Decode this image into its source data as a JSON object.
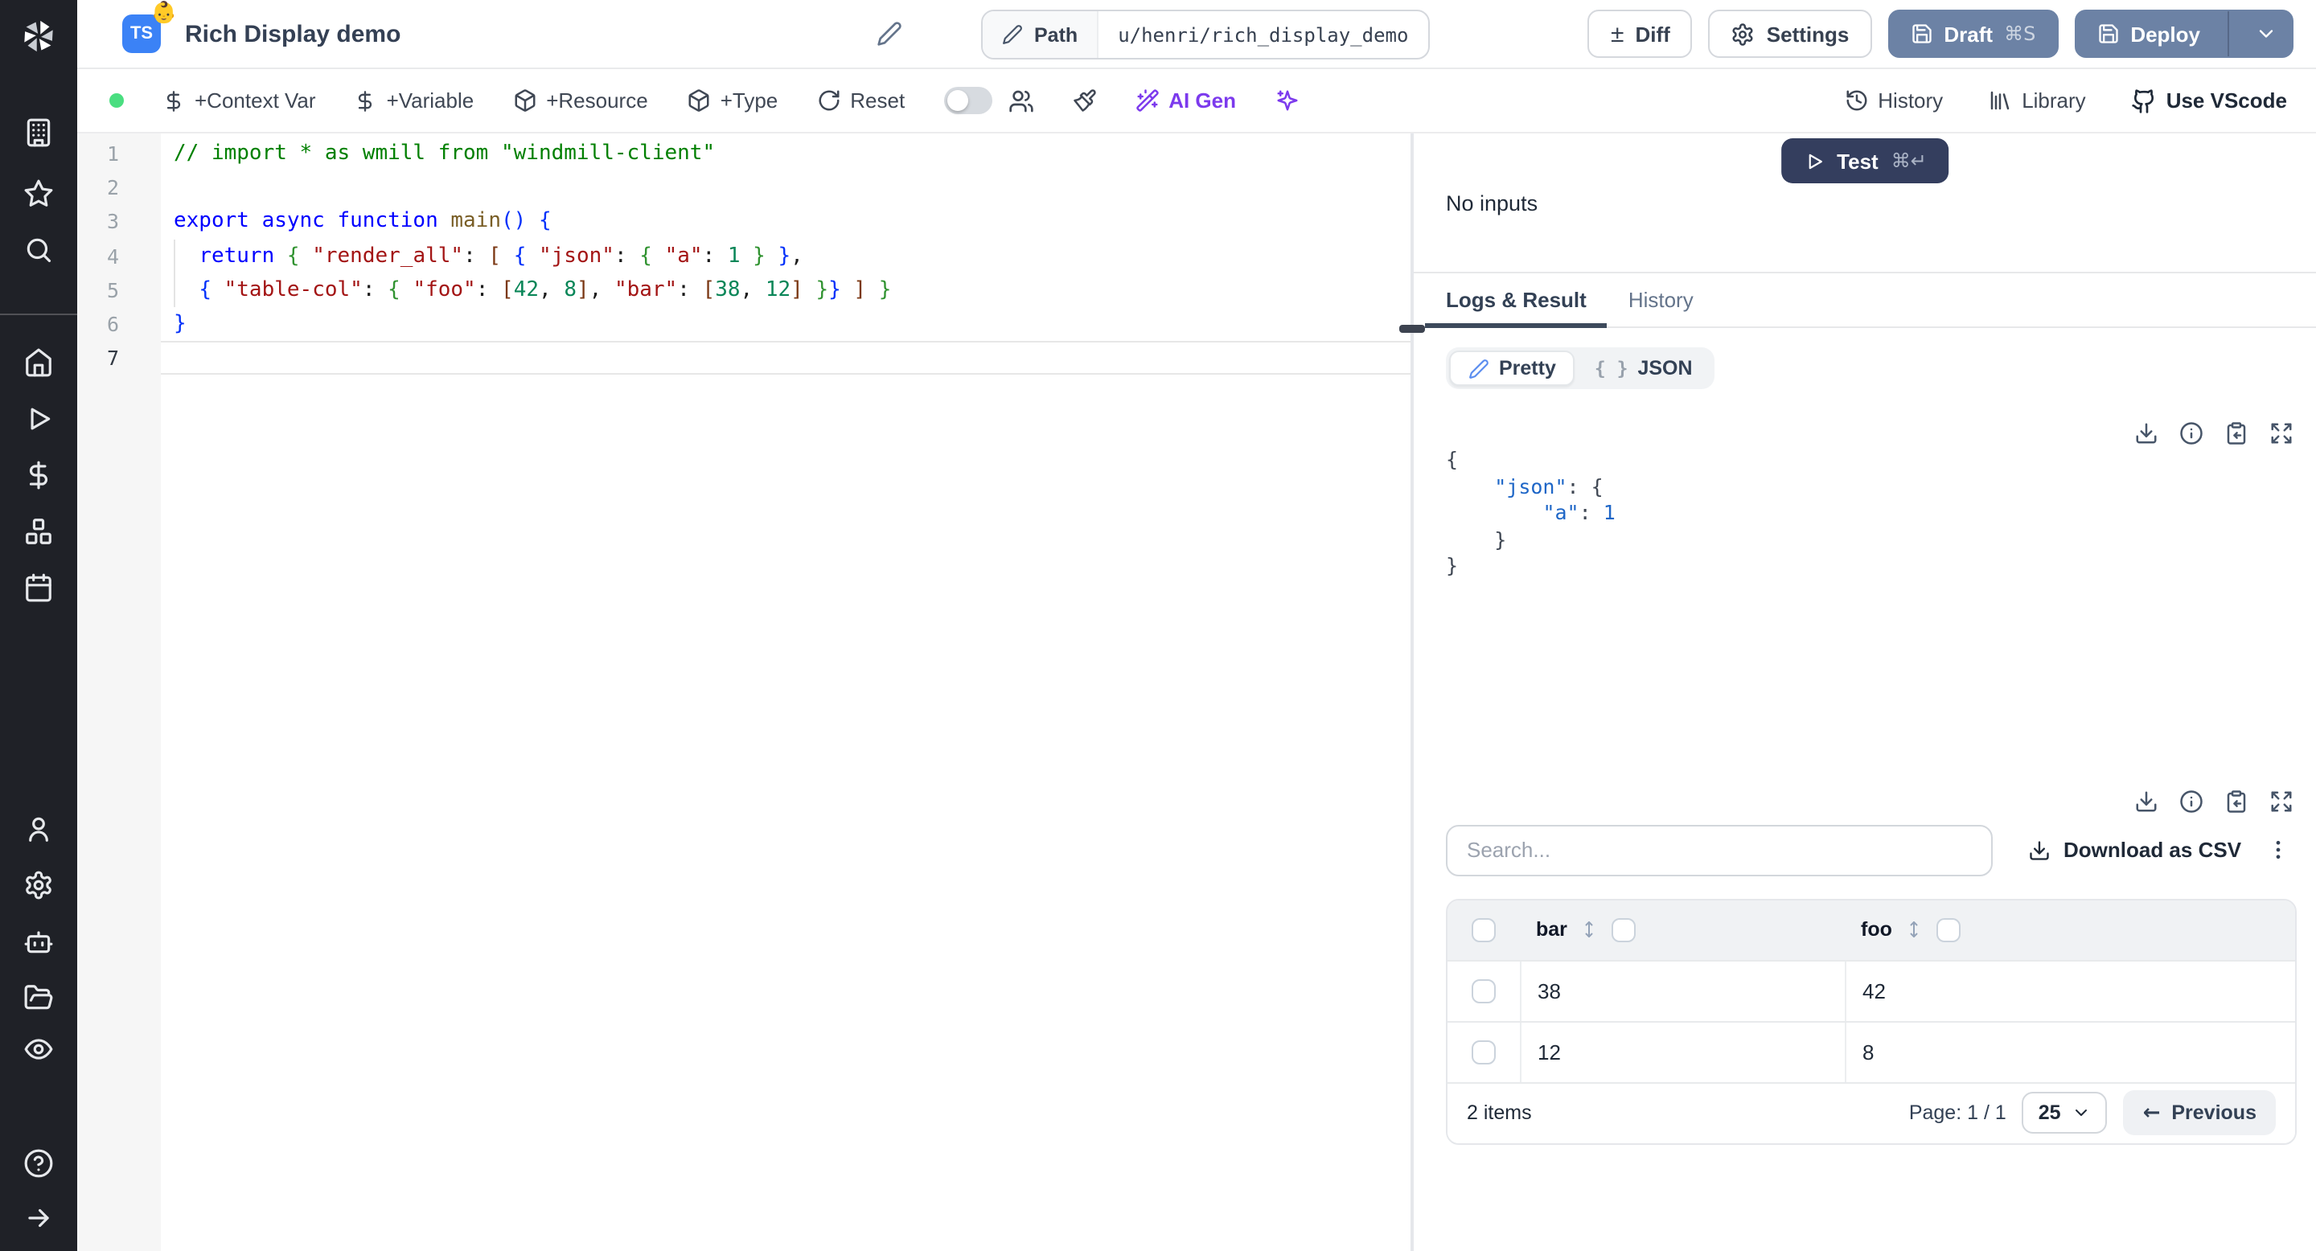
{
  "colors": {
    "sidebar_bg": "#1f2127",
    "accent_blue": "#3b82f6",
    "button_slate": "#6c82a5",
    "test_navy": "#343e5e",
    "ai_purple": "#7c3aed",
    "status_green": "#4ade80",
    "tab_underline": "#3d4a5c"
  },
  "sidebar": {
    "icons": [
      "windmill-logo",
      "building",
      "star",
      "search",
      "home",
      "play",
      "dollar-sign",
      "boxes",
      "calendar",
      "user",
      "settings-gear",
      "robot",
      "folder-open",
      "eye",
      "help-circle",
      "arrow-right"
    ]
  },
  "header": {
    "badge": "TS",
    "emoji": "👶",
    "title": "Rich Display demo",
    "path_label": "Path",
    "path_value": "u/henri/rich_display_demo",
    "diff_icon": "±",
    "diff_label": "Diff",
    "settings_label": "Settings",
    "draft_label": "Draft",
    "draft_shortcut": "⌘S",
    "deploy_label": "Deploy"
  },
  "toolbar": {
    "context_var": "+Context Var",
    "variable": "+Variable",
    "resource": "+Resource",
    "type": "+Type",
    "reset": "Reset",
    "ai_gen": "AI Gen",
    "history": "History",
    "library": "Library",
    "vscode": "Use VScode"
  },
  "editor": {
    "current_line": 7,
    "lines": [
      {
        "segments": [
          [
            "cm",
            "// import * as wmill from \"windmill-client\""
          ]
        ]
      },
      {
        "segments": []
      },
      {
        "segments": [
          [
            "kw",
            "export async function "
          ],
          [
            "fn",
            "main"
          ],
          [
            "b1",
            "()"
          ],
          [
            "pl",
            " "
          ],
          [
            "b1",
            "{"
          ]
        ]
      },
      {
        "guide": true,
        "segments": [
          [
            "pl",
            "  "
          ],
          [
            "kw",
            "return"
          ],
          [
            "pl",
            " "
          ],
          [
            "b2",
            "{"
          ],
          [
            "pl",
            " "
          ],
          [
            "str",
            "\"render_all\""
          ],
          [
            "pl",
            ": "
          ],
          [
            "b3",
            "["
          ],
          [
            "pl",
            " "
          ],
          [
            "b1",
            "{"
          ],
          [
            "pl",
            " "
          ],
          [
            "str",
            "\"json\""
          ],
          [
            "pl",
            ": "
          ],
          [
            "b2",
            "{"
          ],
          [
            "pl",
            " "
          ],
          [
            "str",
            "\"a\""
          ],
          [
            "pl",
            ": "
          ],
          [
            "num",
            "1"
          ],
          [
            "pl",
            " "
          ],
          [
            "b2",
            "}"
          ],
          [
            "pl",
            " "
          ],
          [
            "b1",
            "}"
          ],
          [
            "pl",
            ","
          ]
        ]
      },
      {
        "guide": true,
        "segments": [
          [
            "pl",
            "  "
          ],
          [
            "b1",
            "{"
          ],
          [
            "pl",
            " "
          ],
          [
            "str",
            "\"table-col\""
          ],
          [
            "pl",
            ": "
          ],
          [
            "b2",
            "{"
          ],
          [
            "pl",
            " "
          ],
          [
            "str",
            "\"foo\""
          ],
          [
            "pl",
            ": "
          ],
          [
            "b3",
            "["
          ],
          [
            "num",
            "42"
          ],
          [
            "pl",
            ", "
          ],
          [
            "num",
            "8"
          ],
          [
            "b3",
            "]"
          ],
          [
            "pl",
            ", "
          ],
          [
            "str",
            "\"bar\""
          ],
          [
            "pl",
            ": "
          ],
          [
            "b3",
            "["
          ],
          [
            "num",
            "38"
          ],
          [
            "pl",
            ", "
          ],
          [
            "num",
            "12"
          ],
          [
            "b3",
            "]"
          ],
          [
            "pl",
            " "
          ],
          [
            "b2",
            "}"
          ],
          [
            "b1",
            "}"
          ],
          [
            "pl",
            " "
          ],
          [
            "b3",
            "]"
          ],
          [
            "pl",
            " "
          ],
          [
            "b2",
            "}"
          ]
        ]
      },
      {
        "segments": [
          [
            "b1",
            "}"
          ]
        ]
      },
      {
        "segments": []
      }
    ]
  },
  "run_panel": {
    "test_label": "Test",
    "test_shortcut": "⌘↵",
    "no_inputs": "No inputs"
  },
  "result_panel": {
    "tabs": [
      {
        "label": "Logs & Result",
        "active": true
      },
      {
        "label": "History",
        "active": false
      }
    ],
    "view_pretty": "Pretty",
    "view_json": "JSON",
    "view_json_icon": "{ }",
    "result_lines": [
      {
        "segments": [
          [
            "rpl",
            "{"
          ]
        ]
      },
      {
        "segments": [
          [
            "rpl",
            "    "
          ],
          [
            "rkey",
            "\"json\""
          ],
          [
            "rpl",
            ": {"
          ]
        ]
      },
      {
        "segments": [
          [
            "rpl",
            "        "
          ],
          [
            "rkey",
            "\"a\""
          ],
          [
            "rpl",
            ": "
          ],
          [
            "rnum",
            "1"
          ]
        ]
      },
      {
        "segments": [
          [
            "rpl",
            "    }"
          ]
        ]
      },
      {
        "segments": [
          [
            "rpl",
            "}"
          ]
        ]
      }
    ],
    "search_placeholder": "Search...",
    "download_csv": "Download as CSV",
    "table": {
      "columns": [
        "bar",
        "foo"
      ],
      "rows": [
        [
          "38",
          "42"
        ],
        [
          "12",
          "8"
        ]
      ],
      "items_label": "2 items",
      "page_label": "Page: 1 / 1",
      "page_size": "25",
      "prev_icon": "←",
      "prev_label": "Previous"
    }
  }
}
